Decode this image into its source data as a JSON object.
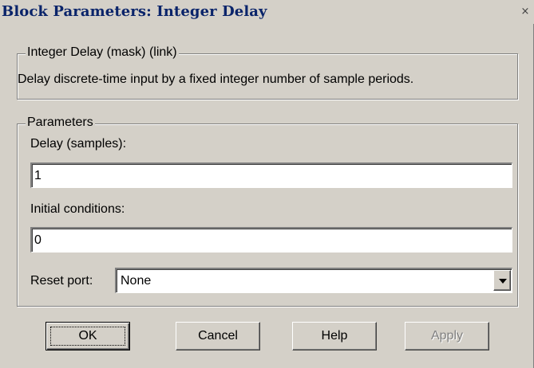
{
  "window": {
    "title": "Block Parameters: Integer Delay",
    "close_glyph": "×"
  },
  "description_group": {
    "legend": "Integer Delay (mask) (link)",
    "text": "Delay discrete-time input by a fixed integer number of sample periods."
  },
  "parameters_group": {
    "legend": "Parameters",
    "delay_label": "Delay (samples):",
    "delay_value": "1",
    "initial_label": "Initial conditions:",
    "initial_value": "0",
    "reset_label": "Reset port:",
    "reset_value": "None"
  },
  "buttons": {
    "ok": "OK",
    "cancel": "Cancel",
    "help": "Help",
    "apply": "Apply"
  }
}
